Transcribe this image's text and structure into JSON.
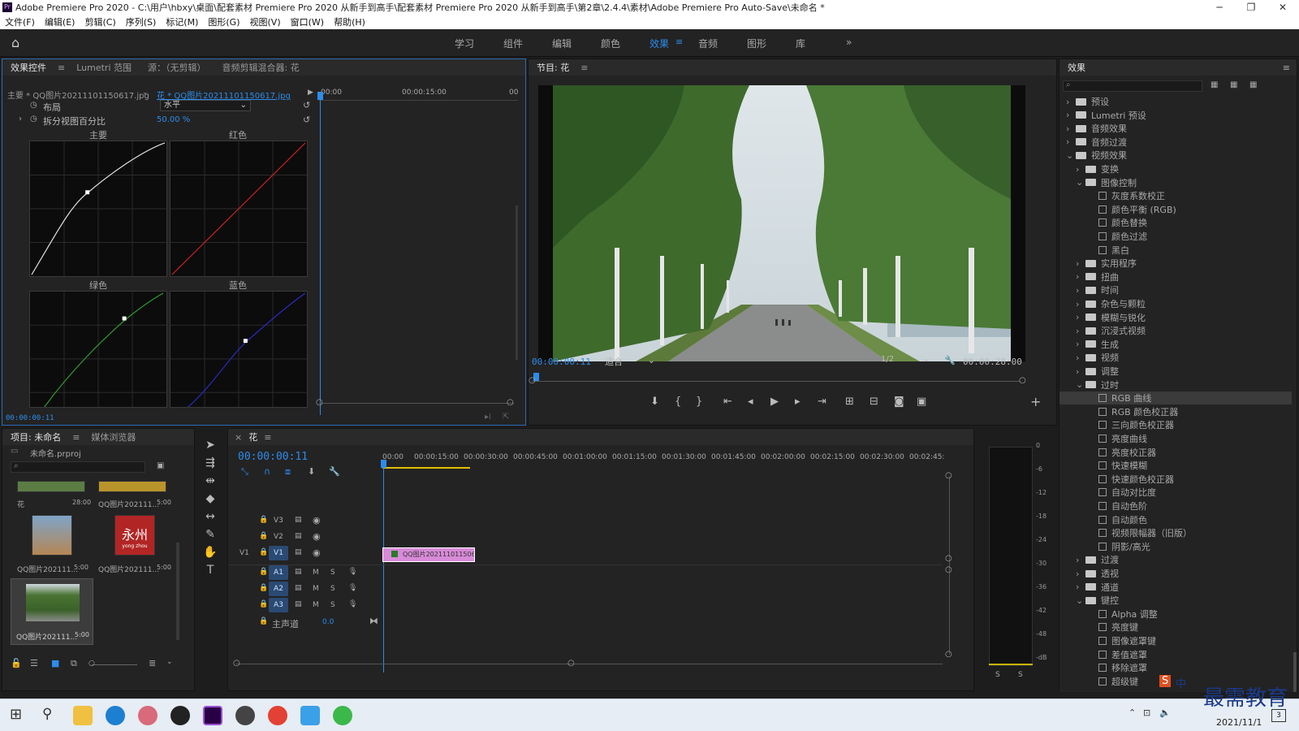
{
  "window": {
    "title": "Adobe Premiere Pro 2020 - C:\\用户\\hbxy\\桌面\\配套素材 Premiere Pro 2020 从新手到高手\\配套素材 Premiere Pro 2020 从新手到高手\\第2章\\2.4.4\\素材\\Adobe Premiere Pro Auto-Save\\未命名 *"
  },
  "menu": [
    "文件(F)",
    "编辑(E)",
    "剪辑(C)",
    "序列(S)",
    "标记(M)",
    "图形(G)",
    "视图(V)",
    "窗口(W)",
    "帮助(H)"
  ],
  "workspaces": [
    "学习",
    "组件",
    "编辑",
    "颜色",
    "效果",
    "音频",
    "图形",
    "库"
  ],
  "workspace_active": "效果",
  "effect_controls": {
    "tabs": [
      "效果控件",
      "Lumetri 范围",
      "源：（无剪辑）",
      "音频剪辑混合器: 花"
    ],
    "master_label": "主要 * QQ图片20211101150617.jpg",
    "clip_label": "花 * QQ图片20211101150617.jpg",
    "ruler_start": "00:00",
    "ruler_mid": "00:00:15:00",
    "ruler_end": "00",
    "layout_label": "布局",
    "layout_value": "水平",
    "split_label": "拆分视图百分比",
    "split_value": "50.00 %",
    "curve_labels": [
      "主要",
      "红色",
      "绿色",
      "蓝色"
    ],
    "timecode": "00:00:00:11"
  },
  "program_monitor": {
    "title": "节目: 花",
    "timecode": "00:00:00:11",
    "fit": "适合",
    "resolution": "1/2",
    "duration": "00:00:28:00"
  },
  "effects_panel": {
    "title": "效果",
    "items": [
      {
        "label": "预设",
        "level": 0,
        "type": "folder",
        "arrow": "›"
      },
      {
        "label": "Lumetri 预设",
        "level": 0,
        "type": "folder",
        "arrow": "›"
      },
      {
        "label": "音频效果",
        "level": 0,
        "type": "folder",
        "arrow": "›"
      },
      {
        "label": "音频过渡",
        "level": 0,
        "type": "folder",
        "arrow": "›"
      },
      {
        "label": "视频效果",
        "level": 0,
        "type": "folder",
        "arrow": "⌄"
      },
      {
        "label": "变换",
        "level": 1,
        "type": "folder",
        "arrow": "›"
      },
      {
        "label": "图像控制",
        "level": 1,
        "type": "folder",
        "arrow": "⌄"
      },
      {
        "label": "灰度系数校正",
        "level": 2,
        "type": "fx"
      },
      {
        "label": "颜色平衡 (RGB)",
        "level": 2,
        "type": "fx"
      },
      {
        "label": "颜色替换",
        "level": 2,
        "type": "fx"
      },
      {
        "label": "颜色过滤",
        "level": 2,
        "type": "fx"
      },
      {
        "label": "黑白",
        "level": 2,
        "type": "fx"
      },
      {
        "label": "实用程序",
        "level": 1,
        "type": "folder",
        "arrow": "›"
      },
      {
        "label": "扭曲",
        "level": 1,
        "type": "folder",
        "arrow": "›"
      },
      {
        "label": "时间",
        "level": 1,
        "type": "folder",
        "arrow": "›"
      },
      {
        "label": "杂色与颗粒",
        "level": 1,
        "type": "folder",
        "arrow": "›"
      },
      {
        "label": "模糊与锐化",
        "level": 1,
        "type": "folder",
        "arrow": "›"
      },
      {
        "label": "沉浸式视频",
        "level": 1,
        "type": "folder",
        "arrow": "›"
      },
      {
        "label": "生成",
        "level": 1,
        "type": "folder",
        "arrow": "›"
      },
      {
        "label": "视频",
        "level": 1,
        "type": "folder",
        "arrow": "›"
      },
      {
        "label": "调整",
        "level": 1,
        "type": "folder",
        "arrow": "›"
      },
      {
        "label": "过时",
        "level": 1,
        "type": "folder",
        "arrow": "⌄"
      },
      {
        "label": "RGB 曲线",
        "level": 2,
        "type": "fx",
        "selected": true
      },
      {
        "label": "RGB 颜色校正器",
        "level": 2,
        "type": "fx"
      },
      {
        "label": "三向颜色校正器",
        "level": 2,
        "type": "fx"
      },
      {
        "label": "亮度曲线",
        "level": 2,
        "type": "fx"
      },
      {
        "label": "亮度校正器",
        "level": 2,
        "type": "fx"
      },
      {
        "label": "快速模糊",
        "level": 2,
        "type": "fx"
      },
      {
        "label": "快速颜色校正器",
        "level": 2,
        "type": "fx"
      },
      {
        "label": "自动对比度",
        "level": 2,
        "type": "fx"
      },
      {
        "label": "自动色阶",
        "level": 2,
        "type": "fx"
      },
      {
        "label": "自动颜色",
        "level": 2,
        "type": "fx"
      },
      {
        "label": "视频限幅器（旧版）",
        "level": 2,
        "type": "fx"
      },
      {
        "label": "阴影/高光",
        "level": 2,
        "type": "fx"
      },
      {
        "label": "过渡",
        "level": 1,
        "type": "folder",
        "arrow": "›"
      },
      {
        "label": "透视",
        "level": 1,
        "type": "folder",
        "arrow": "›"
      },
      {
        "label": "通道",
        "level": 1,
        "type": "folder",
        "arrow": "›"
      },
      {
        "label": "键控",
        "level": 1,
        "type": "folder",
        "arrow": "⌄"
      },
      {
        "label": "Alpha 调整",
        "level": 2,
        "type": "fx"
      },
      {
        "label": "亮度键",
        "level": 2,
        "type": "fx"
      },
      {
        "label": "图像遮罩键",
        "level": 2,
        "type": "fx"
      },
      {
        "label": "差值遮罩",
        "level": 2,
        "type": "fx"
      },
      {
        "label": "移除遮罩",
        "level": 2,
        "type": "fx"
      },
      {
        "label": "超级键",
        "level": 2,
        "type": "fx"
      }
    ]
  },
  "project_panel": {
    "tabs": [
      "项目: 未命名",
      "媒体浏览器"
    ],
    "project_file": "未命名.prproj",
    "items": [
      {
        "name": "花",
        "duration": "28:00"
      },
      {
        "name": "QQ图片202111...",
        "duration": "5:00"
      },
      {
        "name": "QQ图片202111...",
        "duration": "5:00"
      },
      {
        "name": "QQ图片202111...",
        "duration": "5:00"
      },
      {
        "name": "QQ图片202111...",
        "duration": "5:00"
      }
    ],
    "thumb_text": "永州",
    "thumb_subtext": "yong zhou"
  },
  "timeline": {
    "tab": "花",
    "timecode": "00:00:00:11",
    "ruler": [
      "00:00",
      "00:00:15:00",
      "00:00:30:00",
      "00:00:45:00",
      "00:01:00:00",
      "00:01:15:00",
      "00:01:30:00",
      "00:01:45:00",
      "00:02:00:00",
      "00:02:15:00",
      "00:02:30:00",
      "00:02:45:"
    ],
    "video_tracks": [
      "V3",
      "V2",
      "V1"
    ],
    "audio_tracks": [
      "A1",
      "A2",
      "A3"
    ],
    "v1_source": "V1",
    "master_label": "主声道",
    "master_value": "0.0",
    "clip_label": "QQ图片2021110115061",
    "meter_scale": [
      "0",
      "-6",
      "-12",
      "-18",
      "-24",
      "-30",
      "-36",
      "-42",
      "-48",
      "-dB"
    ],
    "solo_labels": [
      "S",
      "S"
    ]
  },
  "taskbar": {
    "time": "",
    "date": "2021/11/1",
    "ime": "中",
    "watermark": "最需教育",
    "notification_count": "3"
  },
  "colors": {
    "accent": "#2d8ceb",
    "clip": "#d88ad8",
    "selected": "#3b3b3b"
  }
}
